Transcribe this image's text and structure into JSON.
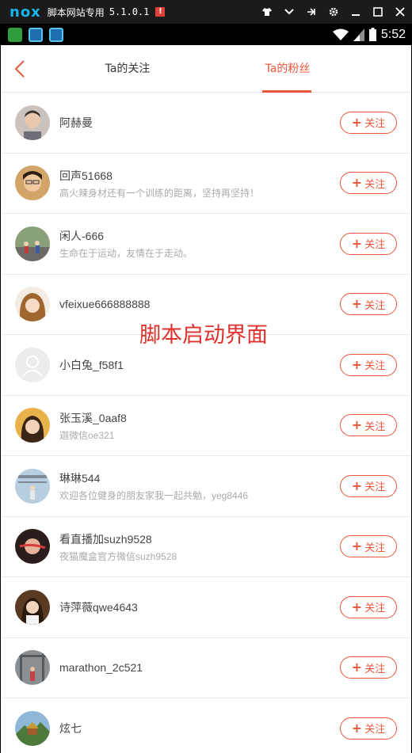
{
  "emulator": {
    "logo": "nox",
    "title": "脚本网站专用",
    "version": "5.1.0.1",
    "badge": "!",
    "controls": [
      "shirt-icon",
      "chevron-down-icon",
      "pin-icon",
      "gear-icon",
      "minimize-icon",
      "maximize-icon",
      "close-icon"
    ]
  },
  "status_bar": {
    "time": "5:52",
    "icons": [
      "wifi-icon",
      "signal-icon",
      "battery-icon"
    ]
  },
  "header": {
    "tab_following": "Ta的关注",
    "tab_fans": "Ta的粉丝",
    "active_tab": "tab_fans"
  },
  "follow_button_label": "关注",
  "users": [
    {
      "name": "阿赫曼",
      "bio": ""
    },
    {
      "name": "回声51668",
      "bio": "高火辣身材还有一个训练的距离，坚持再坚持！"
    },
    {
      "name": "闲人-666",
      "bio": "生命在于运动，友情在于走动。"
    },
    {
      "name": "vfeixue666888888",
      "bio": ""
    },
    {
      "name": "小白兔_f58f1",
      "bio": ""
    },
    {
      "name": "张玉溪_0aaf8",
      "bio": "迦微信oe321"
    },
    {
      "name": "琳琳544",
      "bio": "欢迎各位健身的朋友家我一起共勉，yeg8446"
    },
    {
      "name": "看直播加suzh9528",
      "bio": "夜猫魔盒官方微信suzh9528"
    },
    {
      "name": "诗萍薇qwe4643",
      "bio": ""
    },
    {
      "name": "marathon_2c521",
      "bio": ""
    },
    {
      "name": "炫七",
      "bio": ""
    }
  ],
  "watermark": "脚本启动界面",
  "colors": {
    "accent": "#e8573c",
    "watermark": "#e0322d",
    "nox_logo": "#16b4e8"
  }
}
